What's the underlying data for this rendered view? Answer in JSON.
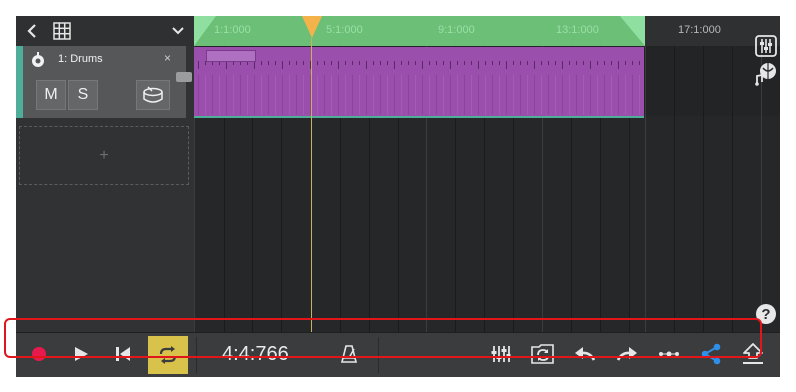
{
  "track": {
    "name": "1: Drums",
    "close_label": "×",
    "mute_label": "M",
    "solo_label": "S",
    "color": "#4fae9a",
    "clip_color": "#9a4fad"
  },
  "add_track": {
    "label": "+"
  },
  "ruler": {
    "labels": [
      "1:1:000",
      "5:1:000",
      "9:1:000",
      "13:1:000",
      "17:1:000"
    ],
    "loop_color": "#6cbf77",
    "playhead_color": "#f4b24a"
  },
  "transport": {
    "time": "4:4:766",
    "loop_active_color": "#d9c24a",
    "record_color": "#e8194d",
    "share_color": "#2f8fe8"
  },
  "help": {
    "label": "?"
  },
  "icons": {
    "back": "chevron-left-icon",
    "grid": "grid-icon",
    "dropdown": "chevron-down-icon",
    "mixer": "mixer-icon",
    "instrument-browser": "instrument-browser-icon",
    "record": "record-icon",
    "play": "play-icon",
    "rewind": "skip-to-start-icon",
    "loop": "loop-icon",
    "metronome": "metronome-icon",
    "sync": "sync-icon",
    "undo": "undo-icon",
    "redo": "redo-icon",
    "more": "more-icon",
    "share": "share-icon",
    "export": "export-icon"
  }
}
